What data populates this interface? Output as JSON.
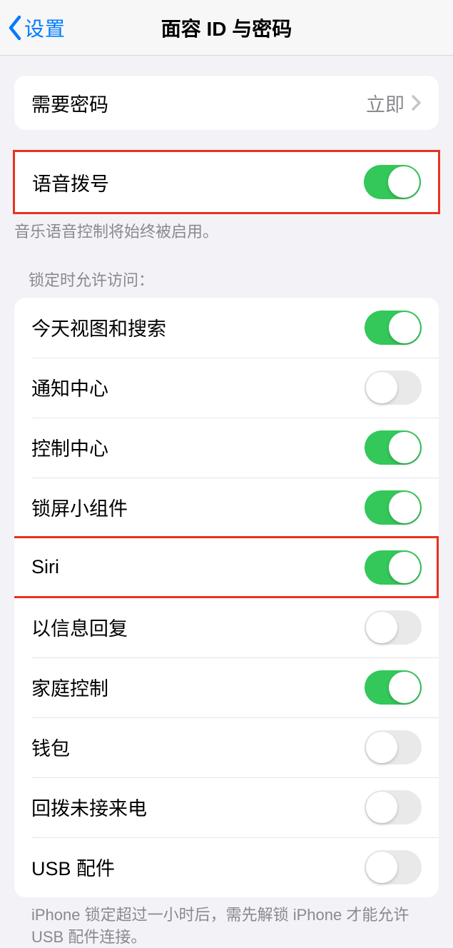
{
  "nav": {
    "back_label": "设置",
    "title": "面容 ID 与密码"
  },
  "require_passcode": {
    "label": "需要密码",
    "value": "立即"
  },
  "voice_dial": {
    "label": "语音拨号",
    "footer": "音乐语音控制将始终被启用。"
  },
  "lock_access": {
    "header": "锁定时允许访问：",
    "items": [
      {
        "label": "今天视图和搜索",
        "on": true
      },
      {
        "label": "通知中心",
        "on": false
      },
      {
        "label": "控制中心",
        "on": true
      },
      {
        "label": "锁屏小组件",
        "on": true
      },
      {
        "label": "Siri",
        "on": true
      },
      {
        "label": "以信息回复",
        "on": false
      },
      {
        "label": "家庭控制",
        "on": true
      },
      {
        "label": "钱包",
        "on": false
      },
      {
        "label": "回拨未接来电",
        "on": false
      },
      {
        "label": "USB 配件",
        "on": false
      }
    ],
    "footer": "iPhone 锁定超过一小时后，需先解锁 iPhone 才能允许USB 配件连接。"
  }
}
